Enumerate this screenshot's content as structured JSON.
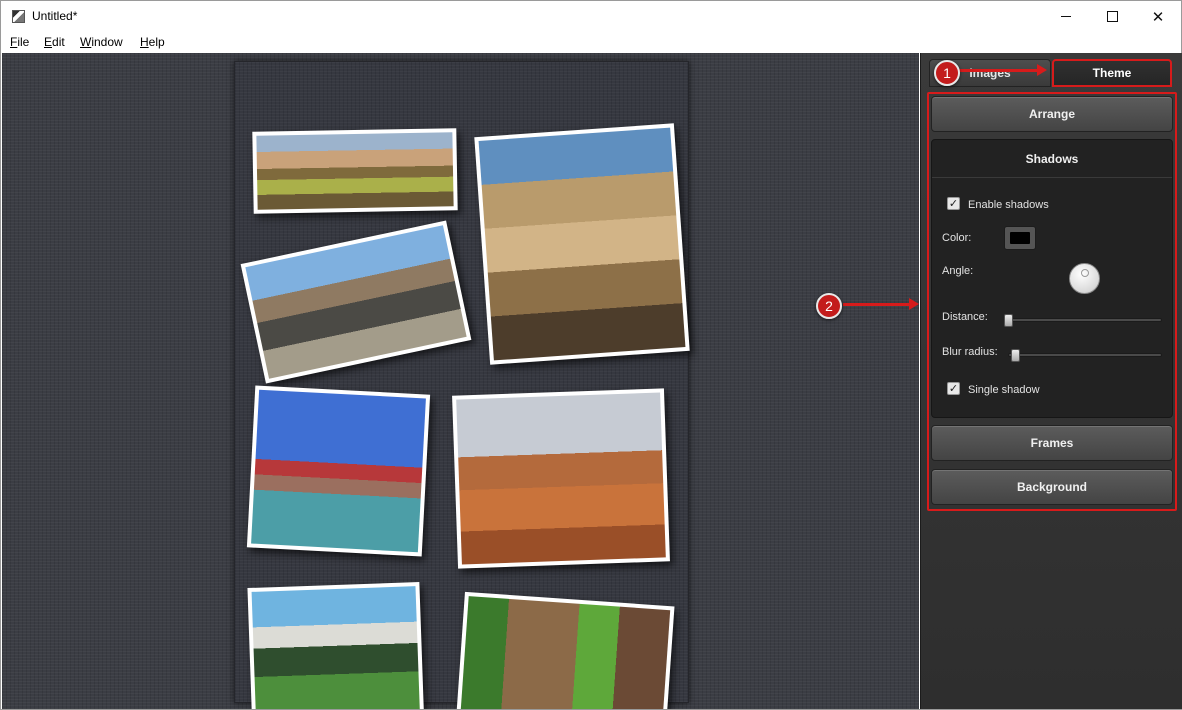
{
  "window": {
    "title": "Untitled*",
    "close_glyph": "✕"
  },
  "menu": [
    {
      "mnemonic": "F",
      "rest": "ile"
    },
    {
      "mnemonic": "E",
      "rest": "dit"
    },
    {
      "mnemonic": "W",
      "rest": "indow"
    },
    {
      "mnemonic": "H",
      "rest": "elp"
    }
  ],
  "panel": {
    "tabs": {
      "images": "Images",
      "theme": "Theme"
    },
    "arrange": "Arrange",
    "shadows": {
      "title": "Shadows",
      "enable_shadows": "Enable shadows",
      "enable_shadows_checked": true,
      "color_label": "Color:",
      "shadow_color": "#000000",
      "angle_label": "Angle:",
      "distance_label": "Distance:",
      "distance_level": 0,
      "blur_label": "Blur radius:",
      "blur_level": 0.02,
      "single_shadow": "Single shadow",
      "single_shadow_checked": true,
      "check_glyph": "✓"
    },
    "frames": "Frames",
    "background": "Background"
  },
  "annotations": {
    "badge_1": "1",
    "badge_2": "2",
    "color": "#d71b1b"
  },
  "collage": {
    "photos": [
      "desert-dunes",
      "canyon-badlands",
      "desert-road",
      "golden-gate-bridge",
      "monument-valley",
      "mountain-meadow",
      "deer"
    ]
  }
}
